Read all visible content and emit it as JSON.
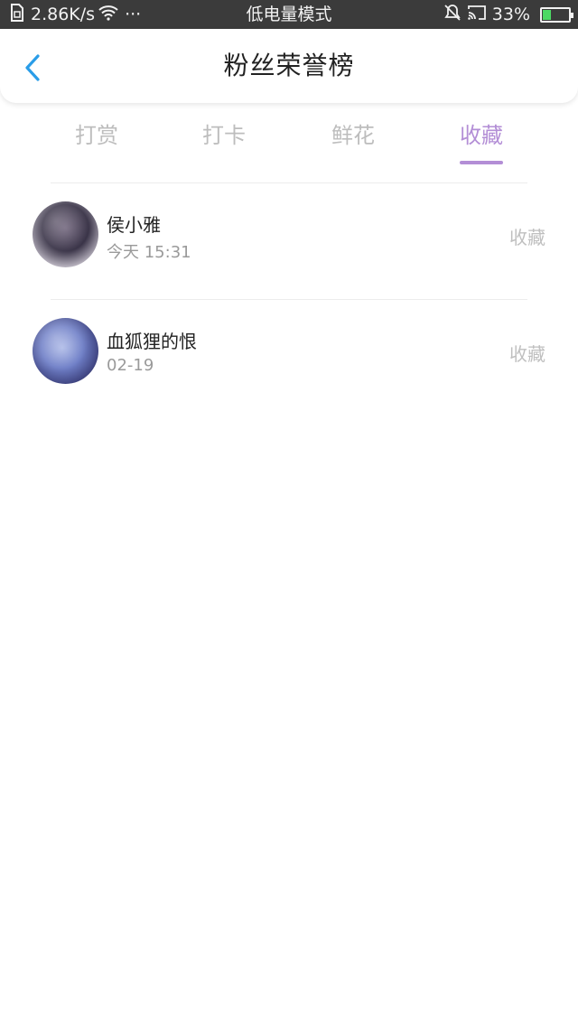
{
  "status_bar": {
    "net_speed": "2.86K/s",
    "more": "···",
    "mode": "低电量模式",
    "battery_percent_text": "33%",
    "battery_level": 0.33,
    "icons": [
      "sim-icon",
      "wifi-icon",
      "mute-icon",
      "cast-icon",
      "battery-icon"
    ]
  },
  "header": {
    "title": "粉丝荣誉榜",
    "back_icon": "chevron-left-icon",
    "back_color": "#2a9de8"
  },
  "tabs": [
    {
      "label": "打赏",
      "active": false
    },
    {
      "label": "打卡",
      "active": false
    },
    {
      "label": "鲜花",
      "active": false
    },
    {
      "label": "收藏",
      "active": true
    }
  ],
  "accent_color": "#b38ed6",
  "list": [
    {
      "name": "侯小雅",
      "time": "今天 15:31",
      "type": "收藏"
    },
    {
      "name": "血狐狸的恨",
      "time": "02-19",
      "type": "收藏"
    }
  ]
}
